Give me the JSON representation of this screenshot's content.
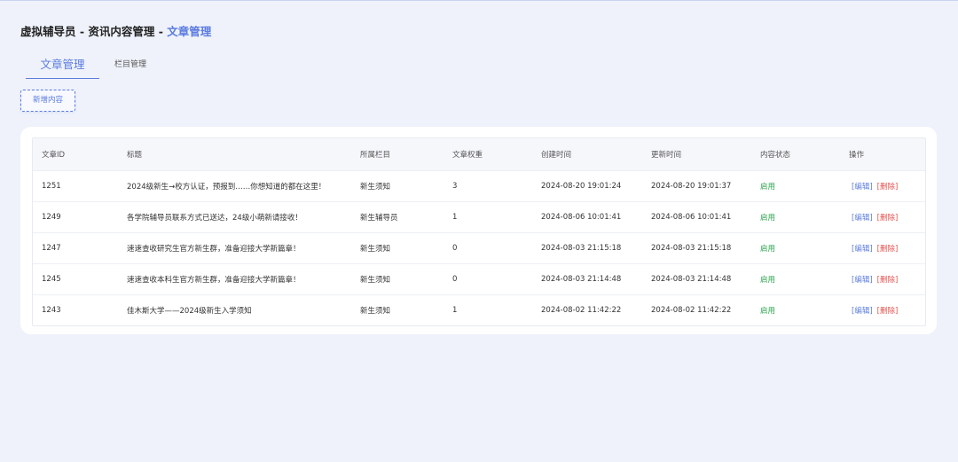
{
  "header": {
    "title_prefix": "虚拟辅导员 - 资讯内容管理 - ",
    "title_current": "文章管理"
  },
  "tabs": [
    {
      "label": "文章管理",
      "active": true
    },
    {
      "label": "栏目管理",
      "active": false
    }
  ],
  "toolbar": {
    "add_label": "新增内容"
  },
  "table": {
    "columns": [
      "文章ID",
      "标题",
      "所属栏目",
      "文章权重",
      "创建时间",
      "更新时间",
      "内容状态",
      "操作"
    ],
    "rows": [
      {
        "id": "1251",
        "title": "2024级新生→校方认证，预报到……你想知道的都在这里！",
        "column": "新生须知",
        "weight": "3",
        "created": "2024-08-20 19:01:24",
        "updated": "2024-08-20 19:01:37",
        "status": "启用"
      },
      {
        "id": "1249",
        "title": "各学院辅导员联系方式已送达，24级小萌新请接收！",
        "column": "新生辅导员",
        "weight": "1",
        "created": "2024-08-06 10:01:41",
        "updated": "2024-08-06 10:01:41",
        "status": "启用"
      },
      {
        "id": "1247",
        "title": "速速查收研究生官方新生群，准备迎接大学新篇章！",
        "column": "新生须知",
        "weight": "0",
        "created": "2024-08-03 21:15:18",
        "updated": "2024-08-03 21:15:18",
        "status": "启用"
      },
      {
        "id": "1245",
        "title": "速速查收本科生官方新生群，准备迎接大学新篇章！",
        "column": "新生须知",
        "weight": "0",
        "created": "2024-08-03 21:14:48",
        "updated": "2024-08-03 21:14:48",
        "status": "启用"
      },
      {
        "id": "1243",
        "title": "佳木斯大学——2024级新生入学须知",
        "column": "新生须知",
        "weight": "1",
        "created": "2024-08-02 11:42:22",
        "updated": "2024-08-02 11:42:22",
        "status": "启用"
      }
    ],
    "edit_label": "[编辑]",
    "delete_label": "[删除]"
  },
  "colors": {
    "accent": "#5b7ce0",
    "status_on": "#2ea44f",
    "danger": "#e4534f",
    "background": "#eff2fa"
  }
}
